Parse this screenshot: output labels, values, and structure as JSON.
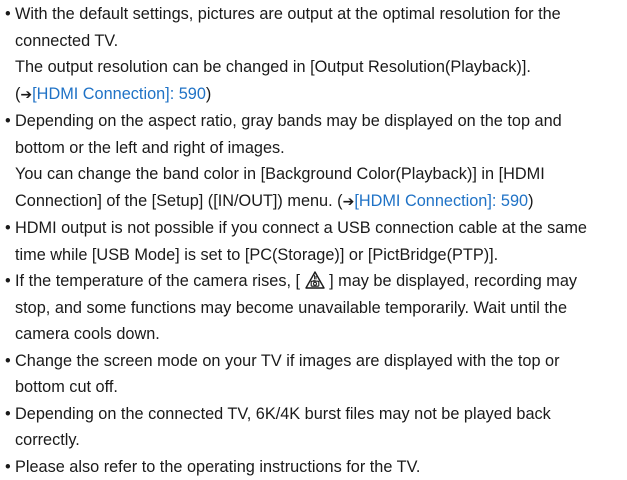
{
  "bullet_glyph": "•",
  "items": [
    {
      "line1": "With the default settings, pictures are output at the optimal resolution for the",
      "line2": "connected TV.",
      "line3": "The output resolution can be changed in [Output Resolution(Playback)].",
      "line4_open": "(",
      "line4_arrow": "➔",
      "line4_link": "[HDMI Connection]: 590",
      "line4_close": ")"
    },
    {
      "line1": "Depending on the aspect ratio, gray bands may be displayed on the top and",
      "line2": "bottom or the left and right of images.",
      "line3": "You can change the band color in [Background Color(Playback)] in [HDMI",
      "line4_pre": "Connection] of the [Setup] ([IN/OUT]) menu. (",
      "line4_arrow": "➔",
      "line4_link": "[HDMI Connection]: 590",
      "line4_close": ")"
    },
    {
      "line1": "HDMI output is not possible if you connect a USB connection cable at the same",
      "line2": "time while [USB Mode] is set to [PC(Storage)] or [PictBridge(PTP)]."
    },
    {
      "line1_pre": "If the temperature of the camera rises, [ ",
      "line1_icon": "temperature-warning-icon",
      "line1_post": " ] may be displayed, recording may",
      "line2": "stop, and some functions may become unavailable temporarily. Wait until the",
      "line3": "camera cools down."
    },
    {
      "line1": "Change the screen mode on your TV if images are displayed with the top or",
      "line2": "bottom cut off."
    },
    {
      "line1": "Depending on the connected TV, 6K/4K burst files may not be played back",
      "line2": "correctly."
    },
    {
      "line1": "Please also refer to the operating instructions for the TV."
    }
  ],
  "colors": {
    "text": "#1a1a1a",
    "link": "#1f72c6"
  }
}
